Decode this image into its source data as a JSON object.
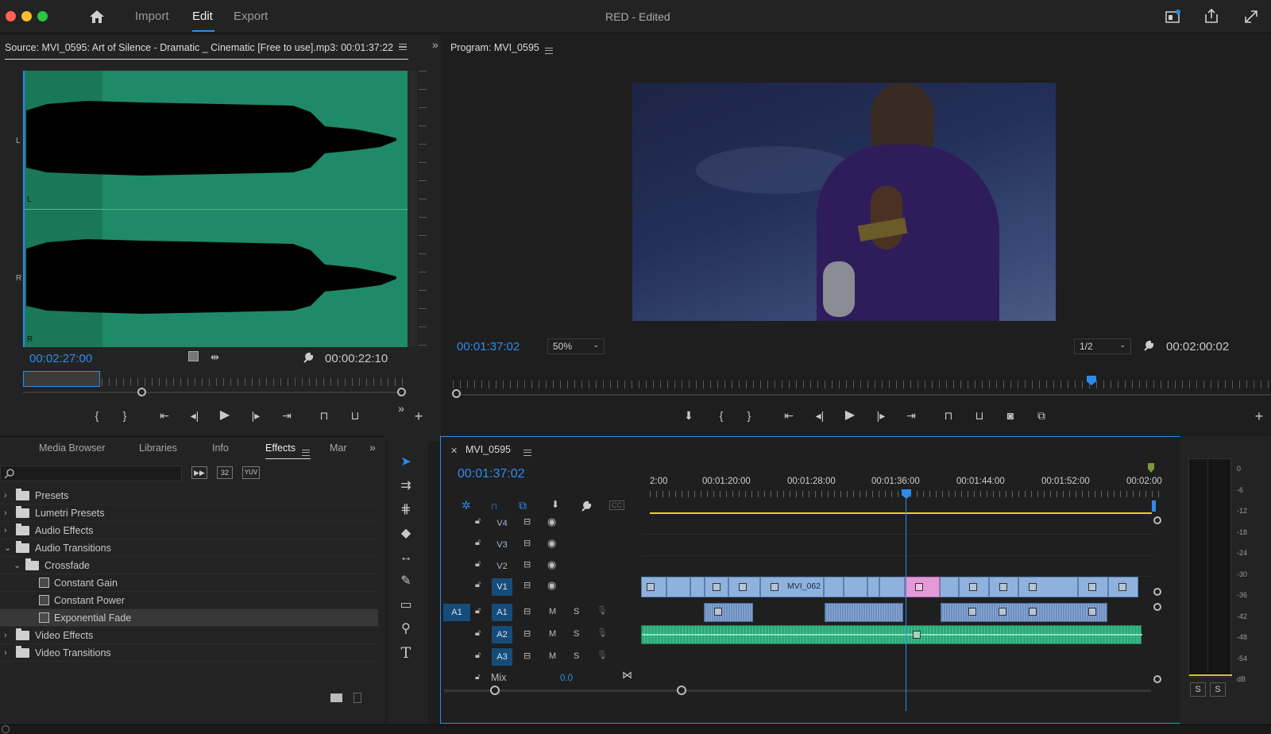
{
  "window": {
    "title": "RED - Edited",
    "tabs": [
      "Import",
      "Edit",
      "Export"
    ],
    "active_tab": "Edit"
  },
  "source": {
    "title": "Source: MVI_0595: Art of Silence - Dramatic _ Cinematic [Free to use].mp3: 00:01:37:22",
    "channel_labels": [
      "L",
      "L",
      "R",
      "R"
    ],
    "timecode": "00:02:27:00",
    "duration": "00:00:22:10"
  },
  "program": {
    "title": "Program: MVI_0595",
    "timecode": "00:01:37:02",
    "zoom": "50%",
    "resolution": "1/2",
    "duration": "00:02:00:02"
  },
  "project_panel": {
    "tabs": [
      "Media Browser",
      "Libraries",
      "Info",
      "Effects",
      "Mar"
    ],
    "active_tab": "Effects",
    "filter_badges": [
      "32",
      "YUV"
    ],
    "items": [
      {
        "label": "Presets",
        "indent": 0,
        "type": "folder-star",
        "expanded": false
      },
      {
        "label": "Lumetri Presets",
        "indent": 0,
        "type": "folder-star",
        "expanded": false
      },
      {
        "label": "Audio Effects",
        "indent": 0,
        "type": "folder",
        "expanded": false
      },
      {
        "label": "Audio Transitions",
        "indent": 0,
        "type": "folder",
        "expanded": true
      },
      {
        "label": "Crossfade",
        "indent": 1,
        "type": "folder",
        "expanded": true
      },
      {
        "label": "Constant Gain",
        "indent": 2,
        "type": "effect"
      },
      {
        "label": "Constant Power",
        "indent": 2,
        "type": "effect"
      },
      {
        "label": "Exponential Fade",
        "indent": 2,
        "type": "effect",
        "selected": true
      },
      {
        "label": "Video Effects",
        "indent": 0,
        "type": "folder",
        "expanded": false
      },
      {
        "label": "Video Transitions",
        "indent": 0,
        "type": "folder",
        "expanded": false
      }
    ]
  },
  "timeline": {
    "sequence": "MVI_0595",
    "timecode": "00:01:37:02",
    "ruler": [
      "2:00",
      "00:01:20:00",
      "00:01:28:00",
      "00:01:36:00",
      "00:01:44:00",
      "00:01:52:00",
      "00:02:00"
    ],
    "cc_label": "CC",
    "video_tracks": [
      "V4",
      "V3",
      "V2",
      "V1"
    ],
    "audio_tracks": [
      "A1",
      "A2",
      "A3"
    ],
    "source_patch": "A1",
    "mute_label": "M",
    "solo_label": "S",
    "mix_label": "Mix",
    "mix_value": "0.0",
    "clip_name": "MVI_062"
  },
  "audio_meter": {
    "scale": [
      "0",
      "-6",
      "-12",
      "-18",
      "-24",
      "-30",
      "-36",
      "-42",
      "-48",
      "-54",
      "dB"
    ],
    "solo_buttons": [
      "S",
      "S"
    ]
  },
  "colors": {
    "accent": "#2d8ceb",
    "waveform_bg": "#1f8a68",
    "clip_video": "#8fb1dd",
    "clip_selected": "#e59ad8",
    "audio_clip_green": "#2fa878"
  }
}
